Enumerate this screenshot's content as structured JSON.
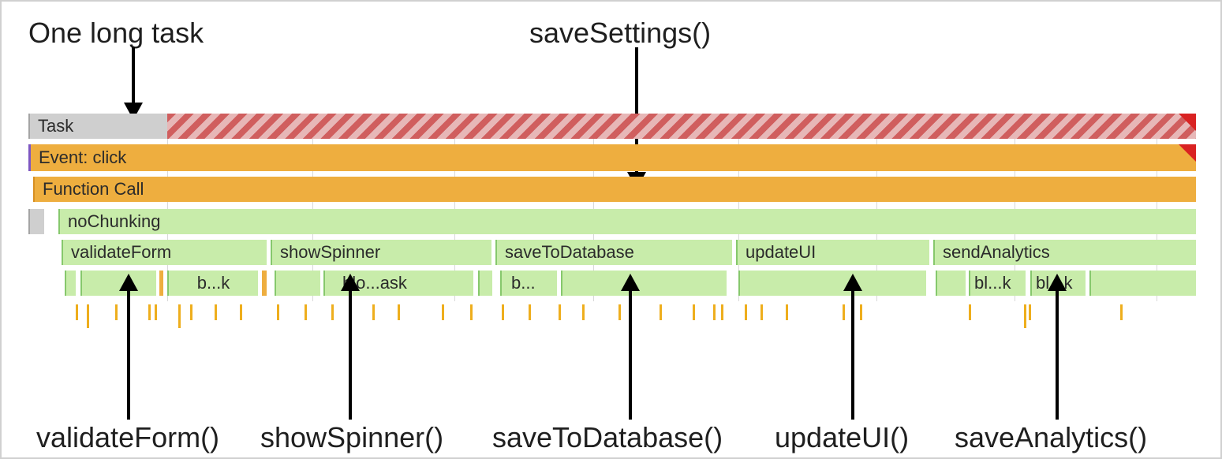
{
  "annotations": {
    "top_left": "One long task",
    "top_right": "saveSettings()",
    "bottom": {
      "0": "validateForm()",
      "1": "showSpinner()",
      "2": "saveToDatabase()",
      "3": "updateUI()",
      "4": "saveAnalytics()"
    }
  },
  "rows": {
    "task_label": "Task",
    "event_label": "Event: click",
    "funccall_label": "Function Call",
    "nochunk_label": "noChunking",
    "calls": {
      "validateForm": "validateForm",
      "showSpinner": "showSpinner",
      "saveToDatabase": "saveToDatabase",
      "updateUI": "updateUI",
      "sendAnalytics": "sendAnalytics"
    },
    "micro": {
      "bk": "b...k",
      "bloask": "blo...ask",
      "b": "b...",
      "blk1": "bl...k",
      "blk2": "bl...k"
    }
  }
}
